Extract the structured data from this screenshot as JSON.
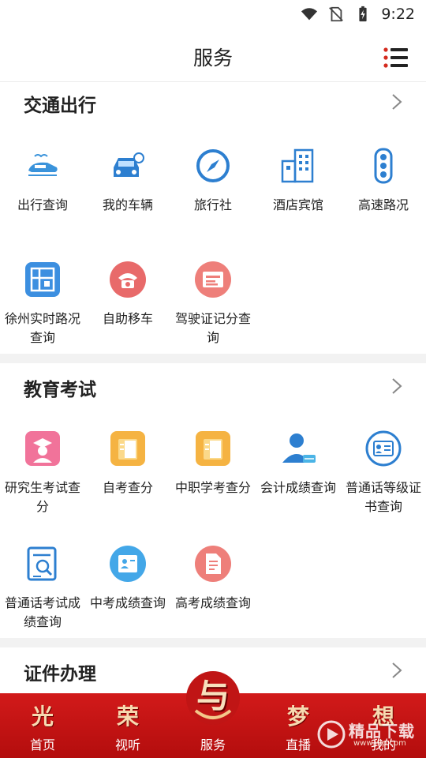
{
  "status_bar": {
    "time": "9:22",
    "icons": [
      "wifi-icon",
      "no-sim-icon",
      "battery-charging-icon"
    ]
  },
  "header": {
    "title": "服务",
    "menu_icon": "list-menu-icon"
  },
  "sections": [
    {
      "title": "交通出行",
      "items": [
        {
          "label": "出行查询",
          "icon": "train-icon"
        },
        {
          "label": "我的车辆",
          "icon": "car-icon"
        },
        {
          "label": "旅行社",
          "icon": "compass-icon"
        },
        {
          "label": "酒店宾馆",
          "icon": "hotel-building-icon"
        },
        {
          "label": "高速路况",
          "icon": "traffic-light-icon"
        },
        {
          "label": "徐州实时路况查询",
          "icon": "road-map-icon"
        },
        {
          "label": "自助移车",
          "icon": "phone-icon"
        },
        {
          "label": "驾驶证记分查询",
          "icon": "license-card-icon"
        }
      ]
    },
    {
      "title": "教育考试",
      "items": [
        {
          "label": "研究生考试查分",
          "icon": "graduate-icon"
        },
        {
          "label": "自考查分",
          "icon": "folder-doc-icon"
        },
        {
          "label": "中职学考查分",
          "icon": "folder-doc-icon"
        },
        {
          "label": "会计成绩查询",
          "icon": "accountant-user-icon"
        },
        {
          "label": "普通话等级证书查询",
          "icon": "certificate-icon"
        },
        {
          "label": "普通话考试成绩查询",
          "icon": "score-document-icon"
        },
        {
          "label": "中考成绩查询",
          "icon": "id-card-icon"
        },
        {
          "label": "高考成绩查询",
          "icon": "exam-paper-icon"
        }
      ]
    },
    {
      "title": "证件办理"
    }
  ],
  "bottom_nav": [
    {
      "glyph": "光",
      "label": "首页"
    },
    {
      "glyph": "荣",
      "label": "视听"
    },
    {
      "glyph": "与",
      "label": "服务"
    },
    {
      "glyph": "梦",
      "label": "直播"
    },
    {
      "glyph": "想",
      "label": "我的"
    }
  ],
  "watermark": {
    "text": "精品下载",
    "url": "www.j9p.com"
  },
  "colors": {
    "nav_red": "#c81414",
    "accent_blue": "#2e88d6",
    "accent_red": "#e05a5a",
    "accent_orange": "#f0a43a"
  }
}
